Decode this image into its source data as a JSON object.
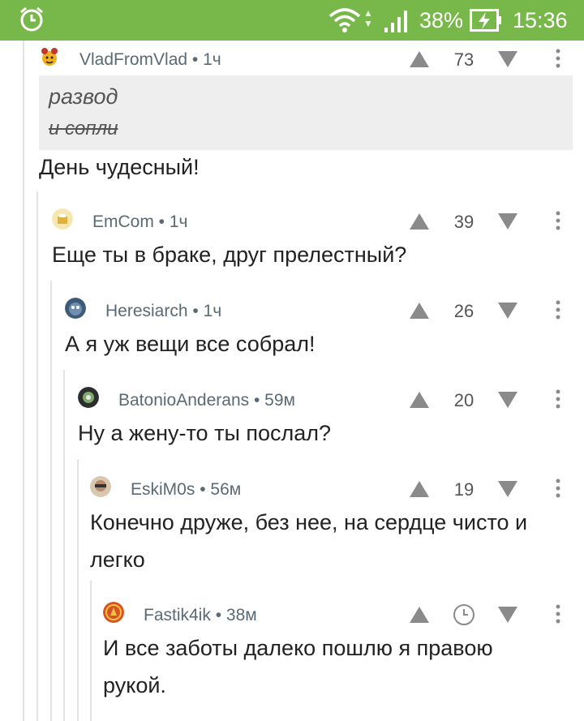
{
  "status_bar": {
    "battery_percent": "38%",
    "time": "15:36",
    "icons": [
      "alarm-icon",
      "wifi-icon",
      "signal-icon",
      "battery-charging-icon"
    ]
  },
  "comments": [
    {
      "author": "VladFromVlad",
      "age": "1ч",
      "score": "73",
      "quote_line1": "развод",
      "quote_line2": "и сопли",
      "text": "День чудесный!"
    },
    {
      "author": "EmCom",
      "age": "1ч",
      "score": "39",
      "text": "Еще ты в браке, друг прелестный?"
    },
    {
      "author": "Heresiarch",
      "age": "1ч",
      "score": "26",
      "text": "А я уж вещи все собрал!"
    },
    {
      "author": "BatonioAnderans",
      "age": "59м",
      "score": "20",
      "text": "Ну а жену-то ты послал?"
    },
    {
      "author": "EskiM0s",
      "age": "56м",
      "score": "19",
      "text_line1": "Конечно друже, без нее, на сердце чисто и",
      "text_line2": "легко"
    },
    {
      "author": "Fastik4ik",
      "age": "38м",
      "text_line1": "И все заботы далеко пошлю я правою",
      "text_line2": "рукой."
    }
  ],
  "separator": " • ",
  "colors": {
    "status_bar": "#78b84a",
    "author": "#5a6a73",
    "vote_icon": "#8a8a8a",
    "guide": "#e3e3e3",
    "quote_bg": "#eeeeee"
  }
}
